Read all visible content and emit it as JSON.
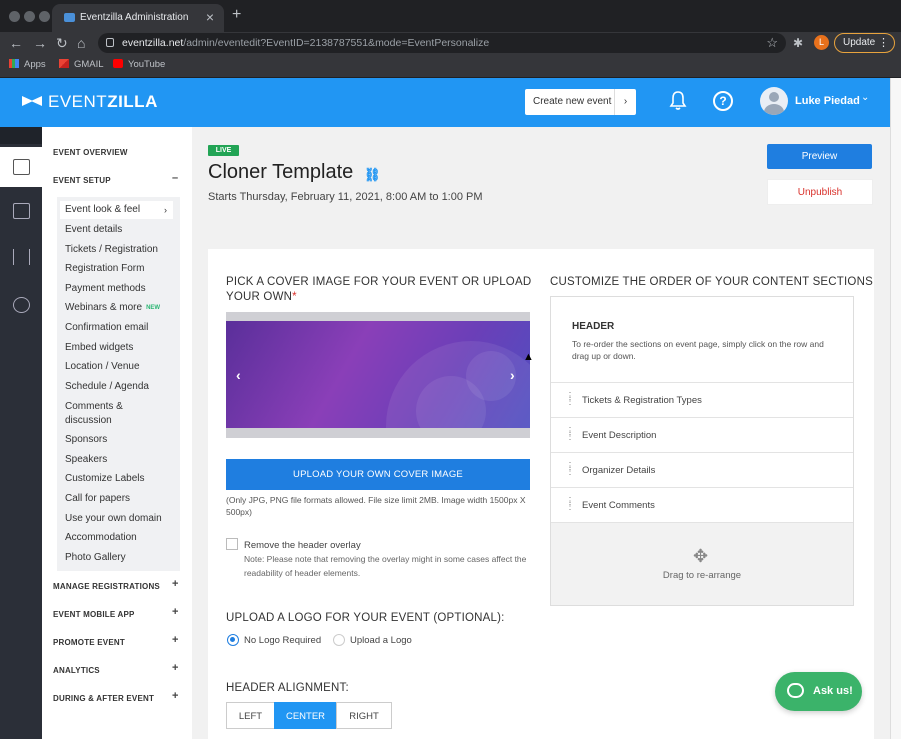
{
  "browser": {
    "tab_title": "Eventzilla Administration",
    "url_domain": "eventzilla.net",
    "url_path": "/admin/eventedit?EventID=2138787551&mode=EventPersonalize",
    "profile_initial": "L",
    "update_label": "Update",
    "bookmarks": [
      {
        "label": "Apps",
        "icon": "apps-grid-icon"
      },
      {
        "label": "GMAIL",
        "icon": "gmail-icon"
      },
      {
        "label": "YouTube",
        "icon": "youtube-icon"
      }
    ]
  },
  "header": {
    "logo_event": "EVENT",
    "logo_zilla": "ZILLA",
    "create_label": "Create new event",
    "user_name": "Luke Piedad",
    "brand_color": "#2196f3"
  },
  "sidebar": {
    "event_overview": "EVENT OVERVIEW",
    "event_setup": "EVENT SETUP",
    "setup_items": [
      "Event look & feel",
      "Event details",
      "Tickets / Registration",
      "Registration Form",
      "Payment methods",
      "Webinars & more",
      "Confirmation email",
      "Embed widgets",
      "Location / Venue",
      "Schedule / Agenda",
      "Comments &",
      "discussion",
      "Sponsors",
      "Speakers",
      "Customize Labels",
      "Call for papers",
      "Use your own domain",
      "Accommodation",
      "Photo Gallery"
    ],
    "new_badge": "NEW",
    "sections": [
      "MANAGE REGISTRATIONS",
      "EVENT MOBILE APP",
      "PROMOTE EVENT",
      "ANALYTICS",
      "DURING & AFTER EVENT"
    ]
  },
  "event": {
    "status": "LIVE",
    "title": "Cloner Template",
    "date": "Starts Thursday, February 11, 2021, 8:00 AM to 1:00 PM",
    "preview_label": "Preview",
    "unpublish_label": "Unpublish"
  },
  "cover": {
    "heading": "PICK A COVER IMAGE FOR YOUR EVENT OR UPLOAD YOUR OWN",
    "required_mark": "*",
    "upload_label": "UPLOAD YOUR OWN COVER IMAGE",
    "format_note": "(Only JPG, PNG file formats allowed. File size limit 2MB. Image width 1500px X 500px)",
    "remove_overlay_label": "Remove the header overlay",
    "remove_overlay_note": "Note: Please note that removing the overlay might in some cases affect the readability of header elements."
  },
  "logo_section": {
    "heading": "UPLOAD A LOGO FOR YOUR EVENT (OPTIONAL):",
    "option_none": "No Logo Required",
    "option_upload": "Upload a Logo"
  },
  "alignment": {
    "heading": "HEADER ALIGNMENT:",
    "options": [
      "LEFT",
      "CENTER",
      "RIGHT"
    ],
    "selected": "CENTER"
  },
  "order": {
    "heading": "CUSTOMIZE THE ORDER OF YOUR CONTENT SECTIONS",
    "header_title": "HEADER",
    "header_desc": "To re-order the sections on event page, simply click on the row and drag up or down.",
    "rows": [
      "Tickets & Registration Types",
      "Event Description",
      "Organizer Details",
      "Event Comments"
    ],
    "drag_label": "Drag to re-arrange"
  },
  "chat": {
    "label": "Ask us!"
  }
}
